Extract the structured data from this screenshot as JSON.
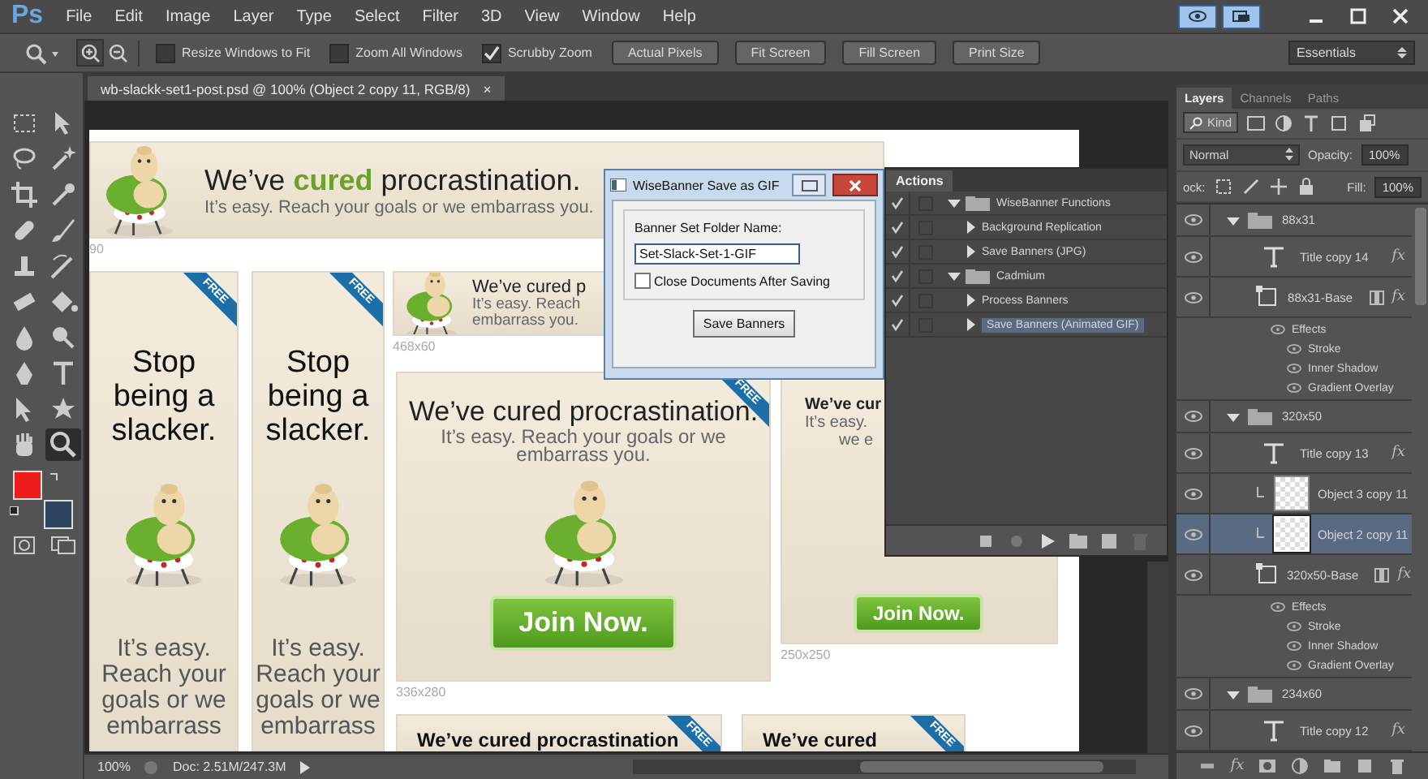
{
  "app": {
    "logo": "Ps"
  },
  "menu": [
    "File",
    "Edit",
    "Image",
    "Layer",
    "Type",
    "Select",
    "Filter",
    "3D",
    "View",
    "Window",
    "Help"
  ],
  "options_bar": {
    "checkboxes": [
      {
        "label": "Resize Windows to Fit",
        "checked": false
      },
      {
        "label": "Zoom All Windows",
        "checked": false
      },
      {
        "label": "Scrubby Zoom",
        "checked": true
      }
    ],
    "buttons": [
      "Actual Pixels",
      "Fit Screen",
      "Fill Screen",
      "Print Size"
    ],
    "workspace": "Essentials"
  },
  "tools": [
    {
      "kind": "marquee",
      "selected": false
    },
    {
      "kind": "move",
      "selected": false
    },
    {
      "kind": "lasso",
      "selected": false
    },
    {
      "kind": "magic-wand",
      "selected": false
    },
    {
      "kind": "crop",
      "selected": false
    },
    {
      "kind": "eyedropper",
      "selected": false
    },
    {
      "kind": "healing",
      "selected": false
    },
    {
      "kind": "brush",
      "selected": false
    },
    {
      "kind": "stamp",
      "selected": false
    },
    {
      "kind": "history-brush",
      "selected": false
    },
    {
      "kind": "eraser",
      "selected": false
    },
    {
      "kind": "bucket",
      "selected": false
    },
    {
      "kind": "blur",
      "selected": false
    },
    {
      "kind": "dodge",
      "selected": false
    },
    {
      "kind": "pen",
      "selected": false
    },
    {
      "kind": "type",
      "selected": false
    },
    {
      "kind": "path-select",
      "selected": false
    },
    {
      "kind": "shape",
      "selected": false
    },
    {
      "kind": "hand",
      "selected": false
    },
    {
      "kind": "zoom",
      "selected": true
    }
  ],
  "swatches": [
    {
      "kind": "foreground",
      "color": "#ee1c1c"
    },
    {
      "kind": "background",
      "color": "#2e4560"
    }
  ],
  "document": {
    "tab_title": "wb-slackk-set1-post.psd @ 100% (Object 2 copy 11, RGB/8)",
    "tab_close": "×",
    "banners": [
      {
        "kind": "leaderboard",
        "headline": "We’ve **cured** procrastination.",
        "subline": "It’s easy.  Reach your goals or we embarrass you.",
        "size_label": "90"
      },
      {
        "kind": "skyscraper",
        "ribbon": "FREE",
        "headline": "Stop being a slacker.",
        "subline": "It’s easy. Reach your goals or we embarrass"
      },
      {
        "kind": "skyscraper",
        "ribbon": "FREE",
        "headline": "Stop being a slacker.",
        "subline": "It’s easy. Reach your goals or we embarrass"
      },
      {
        "kind": "banner",
        "headline": "We’ve cured p",
        "subline": "It’s easy.  Reach",
        "subline_2": "embarrass you.",
        "size_label": "468x60"
      },
      {
        "kind": "rectangle",
        "ribbon": "FREE",
        "headline": "We’ve cured procrastination.",
        "subline": "It’s easy.  Reach your goals or we embarrass you.",
        "button": "Join Now.",
        "size_label": "336x280"
      },
      {
        "kind": "square",
        "headline": "We’ve cur",
        "subline": "It’s easy.",
        "subline_2": "we e",
        "button": "Join Now.",
        "size_label": "250x250"
      },
      {
        "kind": "strip",
        "ribbon": "FREE",
        "headline": "We’ve cured procrastination"
      },
      {
        "kind": "strip",
        "ribbon": "FREE",
        "headline": "We’ve cured"
      }
    ],
    "zoom": "100%",
    "doc_size": "Doc: 2.51M/247.3M"
  },
  "dialog": {
    "title": "WiseBanner Save as GIF",
    "folder_label": "Banner Set Folder Name:",
    "folder_value": "Set-Slack-Set-1-GIF",
    "checkbox": {
      "label": "Close Documents After Saving",
      "checked": false
    },
    "button": "Save Banners"
  },
  "actions": {
    "tab": "Actions",
    "items": [
      {
        "name": "WiseBanner Functions",
        "enabled": true,
        "expanded": true,
        "selected": false,
        "children": [
          {
            "name": "Background Replication",
            "enabled": true,
            "expanded": false,
            "selected": false
          },
          {
            "name": "Save Banners (JPG)",
            "enabled": true,
            "expanded": false,
            "selected": false
          }
        ]
      },
      {
        "name": "Cadmium",
        "enabled": true,
        "expanded": true,
        "selected": false,
        "children": [
          {
            "name": "Process Banners",
            "enabled": true,
            "expanded": false,
            "selected": false
          },
          {
            "name": "Save Banners (Animated GIF)",
            "enabled": true,
            "expanded": false,
            "selected": true
          }
        ]
      }
    ]
  },
  "layers": {
    "tabs": [
      {
        "label": "Layers",
        "selected": true
      },
      {
        "label": "Channels",
        "selected": false
      },
      {
        "label": "Paths",
        "selected": false
      }
    ],
    "filter": "Kind",
    "blend_mode": "Normal",
    "opacity_label": "Opacity:",
    "opacity": "100%",
    "lock_label": "ock:",
    "fill_label": "Fill:",
    "fill": "100%",
    "items": [
      {
        "kind": "group",
        "name": "88x31",
        "visible": true,
        "expanded": true,
        "selected": false,
        "children": [
          {
            "kind": "text",
            "name": "Title copy 14",
            "visible": true,
            "selected": false,
            "fx": "fx"
          },
          {
            "kind": "shape",
            "name": "88x31-Base",
            "visible": true,
            "selected": false,
            "fx": "fx",
            "effects": {
              "label": "Effects",
              "items": [
                "Stroke",
                "Inner Shadow",
                "Gradient Overlay"
              ]
            }
          }
        ]
      },
      {
        "kind": "group",
        "name": "320x50",
        "visible": true,
        "expanded": true,
        "selected": false,
        "children": [
          {
            "kind": "text",
            "name": "Title copy 13",
            "visible": true,
            "selected": false,
            "fx": "fx"
          },
          {
            "kind": "image",
            "name": "Object 3 copy 11",
            "visible": true,
            "selected": false,
            "clipped": true
          },
          {
            "kind": "image",
            "name": "Object 2 copy 11",
            "visible": true,
            "selected": true,
            "clipped": true
          },
          {
            "kind": "shape",
            "name": "320x50-Base",
            "visible": true,
            "selected": false,
            "fx": "fx",
            "effects": {
              "label": "Effects",
              "items": [
                "Stroke",
                "Inner Shadow",
                "Gradient Overlay"
              ]
            }
          }
        ]
      },
      {
        "kind": "group",
        "name": "234x60",
        "visible": true,
        "expanded": true,
        "selected": false,
        "children": [
          {
            "kind": "text",
            "name": "Title copy 12",
            "visible": true,
            "selected": false,
            "fx": "fx"
          }
        ]
      }
    ],
    "footer_fx": "fx"
  }
}
